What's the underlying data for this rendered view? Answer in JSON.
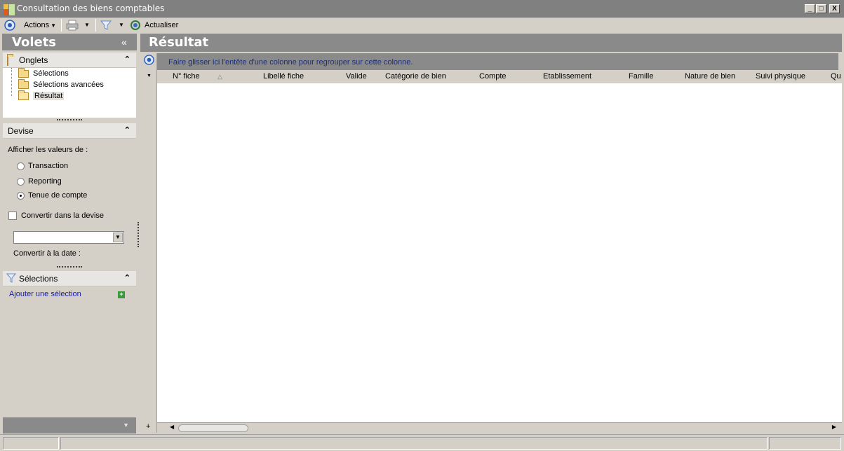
{
  "window": {
    "title": "Consultation des biens comptables",
    "controls": [
      "_",
      "□",
      "X"
    ]
  },
  "toolbar": {
    "actions_label": "Actions",
    "refresh_label": "Actualiser"
  },
  "left_pane": {
    "title": "Volets",
    "collapse_glyph": "«",
    "onglets": {
      "title": "Onglets",
      "items": [
        {
          "label": "Sélections",
          "selected": false
        },
        {
          "label": "Sélections avancées",
          "selected": false
        },
        {
          "label": "Résultat",
          "selected": true
        }
      ]
    },
    "devise": {
      "title": "Devise",
      "show_values_label": "Afficher les valeurs de :",
      "options": [
        {
          "label": "Transaction",
          "checked": false
        },
        {
          "label": "Reporting",
          "checked": false
        },
        {
          "label": "Tenue de compte",
          "checked": true
        }
      ],
      "convert_label": "Convertir dans la devise",
      "convert_checked": false,
      "currency_value": "",
      "convert_date_label": "Convertir à la date :"
    },
    "selections": {
      "title": "Sélections",
      "add_label": "Ajouter une sélection"
    }
  },
  "result": {
    "title": "Résultat",
    "group_hint": "Faire glisser ici l'entête d'une colonne pour regrouper sur cette colonne.",
    "columns": [
      "N° fiche",
      "Libellé fiche",
      "Valide",
      "Catégorie de bien",
      "Compte",
      "Etablissement",
      "Famille",
      "Nature de bien",
      "Suivi physique",
      "Qu"
    ],
    "rows": []
  },
  "colors": {
    "pane_header": "#8a8a8a",
    "link": "#1a1aa8",
    "group_text": "#1a2e7a"
  }
}
